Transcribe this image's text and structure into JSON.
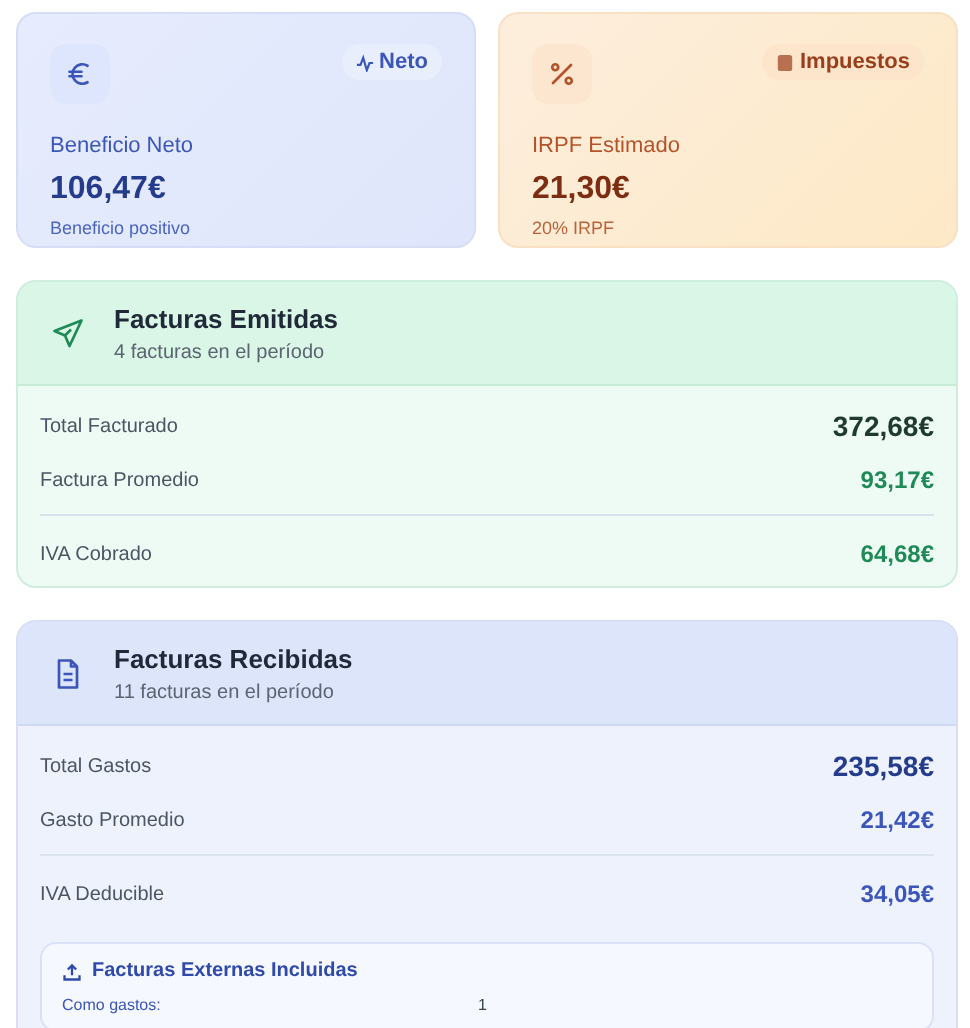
{
  "summary_cards": [
    {
      "kind": "profit",
      "badge": "Neto",
      "label": "Beneficio Neto",
      "value": "106,47€",
      "note": "Beneficio positivo"
    },
    {
      "kind": "tax",
      "badge": "Impuestos",
      "label": "IRPF Estimado",
      "value": "21,30€",
      "note": "20% IRPF"
    }
  ],
  "sections": [
    {
      "kind": "issued",
      "title": "Facturas Emitidas",
      "subtitle": "4 facturas en el período",
      "rows": [
        {
          "kind": "total",
          "label": "Total Facturado",
          "value": "372,68€"
        },
        {
          "kind": "average",
          "label": "Factura Promedio",
          "value": "93,17€"
        },
        {
          "kind": "tax",
          "label": "IVA Cobrado",
          "value": "64,68€"
        }
      ]
    },
    {
      "kind": "received",
      "title": "Facturas Recibidas",
      "subtitle": "11 facturas en el período",
      "rows": [
        {
          "kind": "total",
          "label": "Total Gastos",
          "value": "235,58€"
        },
        {
          "kind": "average",
          "label": "Gasto Promedio",
          "value": "21,42€"
        },
        {
          "kind": "tax",
          "label": "IVA Deducible",
          "value": "34,05€"
        }
      ],
      "external": {
        "title": "Facturas Externas Incluidas",
        "label": "Como gastos:",
        "value": "1"
      }
    }
  ]
}
